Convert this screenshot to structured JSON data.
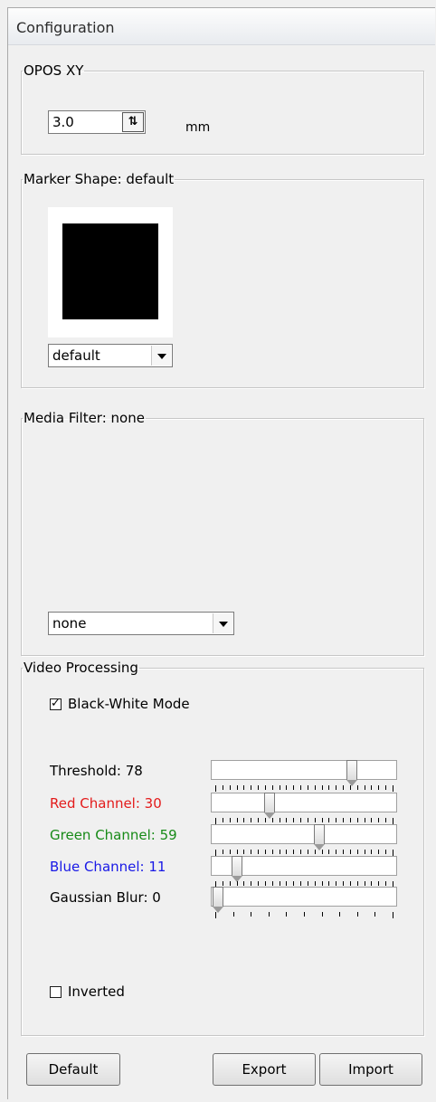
{
  "window": {
    "title": "Configuration"
  },
  "opos": {
    "legend": "OPOS XY",
    "value": "3.0",
    "unit": "mm",
    "spin_icon": "spin-up-down-icon"
  },
  "marker": {
    "legend": "Marker Shape: default",
    "selected": "default"
  },
  "media": {
    "legend": "Media Filter: none",
    "selected": "none"
  },
  "video": {
    "legend": "Video Processing",
    "bw_label": "Black-White Mode",
    "bw_checked": true,
    "sliders": [
      {
        "label": "Threshold: 78",
        "color": "#000000",
        "value": 78,
        "max": 100
      },
      {
        "label": "Red Channel: 30",
        "color": "#e31b1b",
        "value": 30,
        "max": 100
      },
      {
        "label": "Green Channel: 59",
        "color": "#178a17",
        "value": 59,
        "max": 100
      },
      {
        "label": "Blue Channel: 11",
        "color": "#1818e6",
        "value": 11,
        "max": 100
      },
      {
        "label": "Gaussian Blur: 0",
        "color": "#000000",
        "value": 0,
        "max": 10
      }
    ],
    "inverted_label": "Inverted",
    "inverted_checked": false
  },
  "buttons": {
    "default": "Default",
    "export": "Export",
    "import": "Import"
  }
}
